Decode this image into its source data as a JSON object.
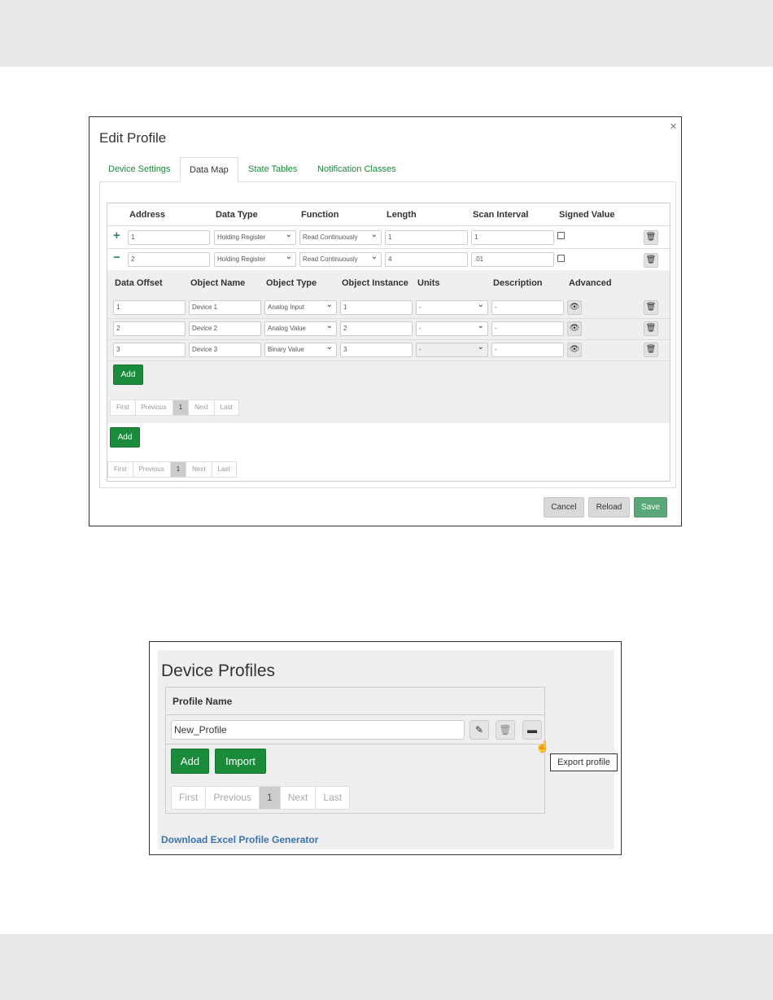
{
  "edit_profile": {
    "title": "Edit Profile",
    "close_label": "×",
    "tabs": [
      "Device Settings",
      "Data Map",
      "State Tables",
      "Notification Classes"
    ],
    "active_tab": "Data Map",
    "register_headers": [
      "Address",
      "Data Type",
      "Function",
      "Length",
      "Scan Interval",
      "Signed Value"
    ],
    "registers": [
      {
        "toggle": "+",
        "address": "1",
        "data_type": "Holding Register",
        "function": "Read Continuously",
        "length": "1",
        "scan_interval": "1",
        "signed": false
      },
      {
        "toggle": "−",
        "address": "2",
        "data_type": "Holding Register",
        "function": "Read Continuously",
        "length": "4",
        "scan_interval": ".01",
        "signed": false
      }
    ],
    "object_headers": [
      "Data Offset",
      "Object Name",
      "Object Type",
      "Object Instance",
      "Units",
      "Description",
      "Advanced"
    ],
    "objects": [
      {
        "offset": "1",
        "name": "Device 1",
        "type": "Analog Input",
        "instance": "1",
        "units": "-",
        "description": "-",
        "units_disabled": false
      },
      {
        "offset": "2",
        "name": "Device 2",
        "type": "Analog Value",
        "instance": "2",
        "units": "-",
        "description": "-",
        "units_disabled": false
      },
      {
        "offset": "3",
        "name": "Device 3",
        "type": "Binary Value",
        "instance": "3",
        "units": "-",
        "description": "-",
        "units_disabled": true
      }
    ],
    "add_label": "Add",
    "pager": [
      "First",
      "Previous",
      "1",
      "Next",
      "Last"
    ],
    "current_page": "1",
    "buttons": {
      "cancel": "Cancel",
      "reload": "Reload",
      "save": "Save"
    },
    "icons": {
      "delete": "trash-icon",
      "advanced": "eye-icon"
    }
  },
  "device_profiles": {
    "title": "Device Profiles",
    "column_header": "Profile Name",
    "profile_name": "New_Profile",
    "add_label": "Add",
    "import_label": "Import",
    "pager": [
      "First",
      "Previous",
      "1",
      "Next",
      "Last"
    ],
    "current_page": "1",
    "tooltip": "Export profile",
    "download_link": "Download Excel Profile Generator",
    "icons": {
      "edit": "pencil-icon",
      "delete": "trash-icon",
      "export": "export-icon"
    }
  },
  "colors": {
    "accent_green": "#1a8a3b",
    "save_green": "#5aa877",
    "link_blue": "#3a73b0",
    "band_grey": "#e6e7e8"
  }
}
